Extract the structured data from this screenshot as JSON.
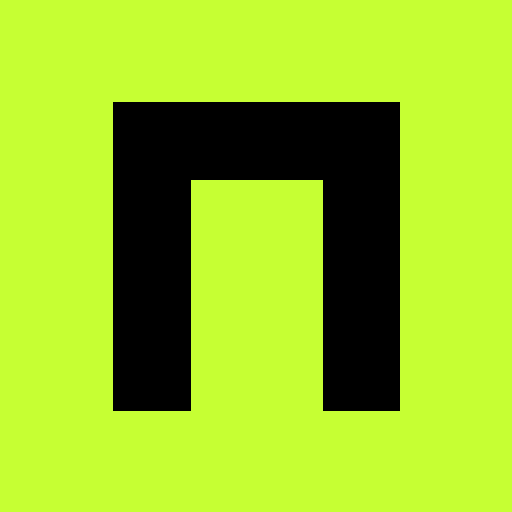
{
  "icon": {
    "name": "arch-logo-icon",
    "colors": {
      "background": "#c6ff33",
      "foreground": "#000000"
    }
  }
}
